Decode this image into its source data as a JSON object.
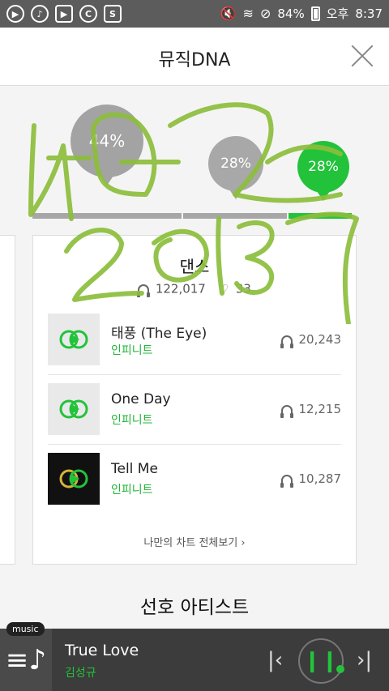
{
  "status_bar": {
    "battery": "84%",
    "ampm": "오후",
    "time": "8:37"
  },
  "header": {
    "title": "뮤직DNA"
  },
  "bubbles": [
    {
      "value": "44%"
    },
    {
      "value": "28%"
    },
    {
      "value": "28%"
    }
  ],
  "card": {
    "genre": "댄스",
    "listens": "122,017",
    "likes": "33",
    "tracks": [
      {
        "name": "태풍 (The Eye)",
        "artist": "인피니트",
        "plays": "20,243"
      },
      {
        "name": "One Day",
        "artist": "인피니트",
        "plays": "12,215"
      },
      {
        "name": "Tell Me",
        "artist": "인피니트",
        "plays": "10,287"
      }
    ],
    "more_link": "나만의 차트 전체보기 ›"
  },
  "section_title": "선호 아티스트",
  "player": {
    "badge": "music",
    "track": "True Love",
    "artist": "김성규"
  },
  "colors": {
    "accent": "#22c33a",
    "gray_bubble": "#a3a3a3",
    "player_bg": "#3c3c3c",
    "handwriting": "#8cbe3c"
  }
}
